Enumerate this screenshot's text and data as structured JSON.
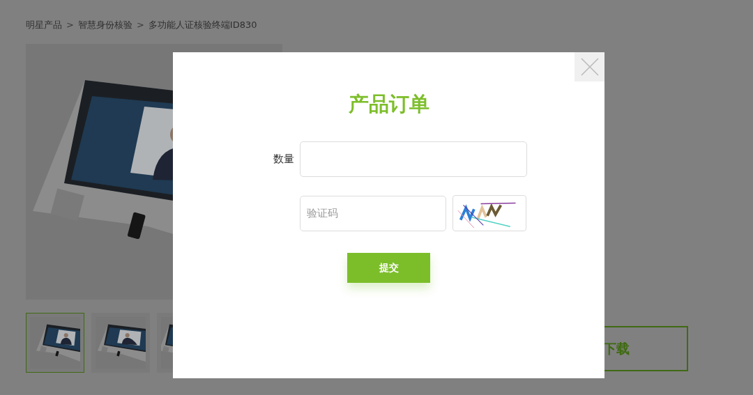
{
  "breadcrumb": [
    {
      "kind": "link",
      "text": "明星产品"
    },
    {
      "kind": "separator",
      "text": ">"
    },
    {
      "kind": "link",
      "text": "智慧身份核验"
    },
    {
      "kind": "separator",
      "text": ">"
    },
    {
      "kind": "current",
      "text": "多功能人证核验终端ID830"
    }
  ],
  "product": {
    "thumbnails": [
      {
        "selected": true
      },
      {
        "selected": false
      },
      {
        "selected": false
      }
    ],
    "download_button": "下载"
  },
  "modal": {
    "title": "产品订单",
    "fields": [
      {
        "kind": "text",
        "label": "数量"
      },
      {
        "kind": "captcha",
        "placeholder": "验证码"
      }
    ],
    "submit": "提交"
  }
}
